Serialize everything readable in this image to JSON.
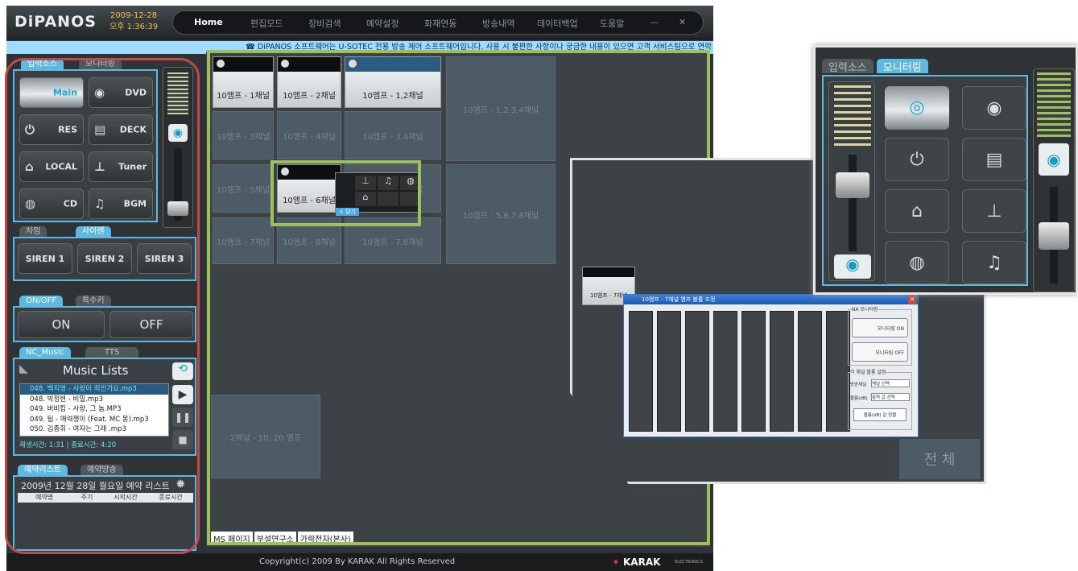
{
  "app": {
    "logo": "DiPANOS",
    "date": "2009-12-28",
    "time": "오후 1:36:39"
  },
  "nav": {
    "items": [
      "Home",
      "편집모드",
      "장비검색",
      "예약설정",
      "화재연동",
      "방송내역",
      "데이터백업",
      "도움말"
    ],
    "minimize": "—",
    "close": "✕"
  },
  "ticker": "☎ DiPANOS 소프트웨어는 U-SOTEC 전용 방송 제어 소프트웨어입니다. 사용 시 불편한 사항이나 궁금한 내용이 있으면 고객 서비스팀으로 연락",
  "input": {
    "tabs": [
      "입력소스",
      "모니터링"
    ],
    "buttons": [
      {
        "icon": "◎",
        "label": "Main"
      },
      {
        "icon": "◉",
        "label": "DVD"
      },
      {
        "icon": "⏻",
        "label": "RES"
      },
      {
        "icon": "▤",
        "label": "DECK"
      },
      {
        "icon": "⌂",
        "label": "LOCAL"
      },
      {
        "icon": "⊥",
        "label": "Tuner"
      },
      {
        "icon": "◍",
        "label": "CD"
      },
      {
        "icon": "♫",
        "label": "BGM"
      }
    ]
  },
  "siren": {
    "tabs": [
      "차임",
      "사이렌"
    ],
    "buttons": [
      "SIREN 1",
      "SIREN 2",
      "SIREN 3"
    ]
  },
  "onoff": {
    "tabs": [
      "ON/OFF",
      "특수키"
    ],
    "on": "ON",
    "off": "OFF"
  },
  "music": {
    "tabs": [
      "NC_Music",
      "TTS"
    ],
    "title": "Music Lists",
    "items": [
      "048. 백지영 - 사랑이 죄인가요.mp3",
      "048. 박정현 - 비밀.mp3",
      "049. 버비킴 - 사랑, 그 놈.MP3",
      "049. 팀 - 매력쟁이 (Feat. MC 몽).mp3",
      "050. 김종휘 - 여자는 그래 .mp3"
    ],
    "status": "재생시간: 1:31 | 종료시간: 4:20"
  },
  "reserve": {
    "tabs": [
      "예약리스트",
      "예약방송"
    ],
    "header": "2009년 12월 28일 월요일 예약 리스트",
    "columns": [
      "예약명",
      "주기",
      "시작시간",
      "종료시간"
    ]
  },
  "zones": {
    "cells": [
      "10앰프 - 1채널",
      "10앰프 - 2채널",
      "10앰프 - 1,2채널",
      "10앰프 - 1,2,3,4채널",
      "10앰프 - 3채널",
      "10앰프 - 4채널",
      "10앰프 - 3,4채널",
      "10앰프 - 5채널",
      "10앰프 - 6채널",
      "10앰프 - 5,6채널",
      "10앰프 - 5,6,7,8채널",
      "10앰프 - 7채널",
      "10앰프 - 8채널",
      "10앰프 - 7,8채널",
      "2채널 - 10, 20 앰프"
    ],
    "popup_close": "× 닫기",
    "tabs": [
      "MS 페이지",
      "부설연구소",
      "가락전자(본사)"
    ]
  },
  "dialog": {
    "title": "10앰프 - 7채널 앰프 볼륨 조정",
    "monitor_title": "NA 모니터링",
    "monitor_on": "모니터링 ON",
    "monitor_off": "모니터링 OFF",
    "vol_title": "각 채널 볼륨 설정",
    "ch_label": "방송채널",
    "ch_select": "채널 선택",
    "vol_label": "볼륨(dB)",
    "vol_select": "출력 값 선택",
    "apply": "볼륨(dB) 값 정렬"
  },
  "zoom2": {
    "tabs": [
      "입력소스",
      "모니터링"
    ]
  },
  "zoom1": {
    "cell": "10앰프 - 7채널",
    "big": "전 체"
  },
  "footer": {
    "copyright": "Copyright(c) 2009 By KARAK All Rights Reserved",
    "brand": "KARAK",
    "brand_sub": "ELECTRONICS"
  }
}
